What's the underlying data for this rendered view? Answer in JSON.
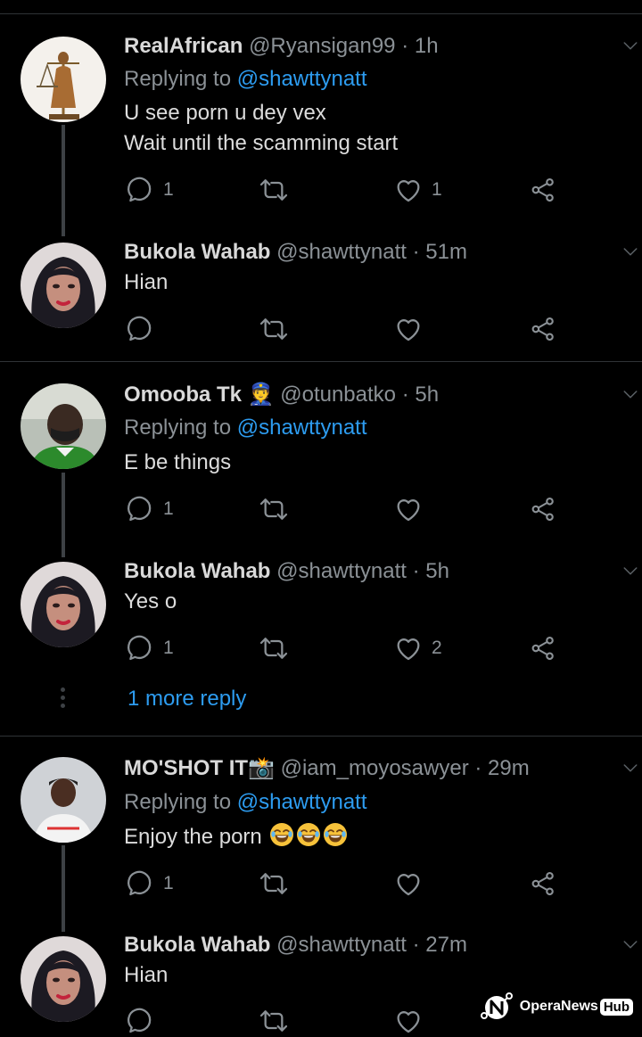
{
  "tweets": [
    {
      "name": "RealAfrican",
      "handle": "@Ryansigan99",
      "time": "1h",
      "replying_prefix": "Replying to",
      "replying_to": "@shawttynatt",
      "lines": [
        "U see porn u dey vex",
        "Wait until the scamming start"
      ],
      "reply_count": "1",
      "retweet_count": "",
      "like_count": "1"
    },
    {
      "name": "Bukola Wahab",
      "handle": "@shawttynatt",
      "time": "51m",
      "lines": [
        "Hian"
      ],
      "reply_count": "",
      "retweet_count": "",
      "like_count": ""
    },
    {
      "name": "Omooba Tk 👮",
      "handle": "@otunbatko",
      "time": "5h",
      "replying_prefix": "Replying to",
      "replying_to": "@shawttynatt",
      "lines": [
        "E be things"
      ],
      "reply_count": "1",
      "retweet_count": "",
      "like_count": ""
    },
    {
      "name": "Bukola Wahab",
      "handle": "@shawttynatt",
      "time": "5h",
      "lines": [
        "Yes o"
      ],
      "reply_count": "1",
      "retweet_count": "",
      "like_count": "2"
    },
    {
      "name": "MO'SHOT IT📸",
      "handle": "@iam_moyosawyer",
      "time": "29m",
      "replying_prefix": "Replying to",
      "replying_to": "@shawttynatt",
      "lines": [
        "Enjoy the porn"
      ],
      "reply_count": "1",
      "retweet_count": "",
      "like_count": ""
    },
    {
      "name": "Bukola Wahab",
      "handle": "@shawttynatt",
      "time": "27m",
      "lines": [
        "Hian"
      ],
      "reply_count": "",
      "retweet_count": "",
      "like_count": ""
    }
  ],
  "more_replies": "1 more reply",
  "separator": "·",
  "watermark": {
    "brand": "OperaNews",
    "hub": "Hub"
  },
  "colors": {
    "background": "#000000",
    "link": "#2d9cf0",
    "muted": "#8b9196"
  },
  "icons": [
    "reply-icon",
    "retweet-icon",
    "like-icon",
    "share-icon",
    "chevron-down-icon",
    "laughing-emoji-icon"
  ]
}
